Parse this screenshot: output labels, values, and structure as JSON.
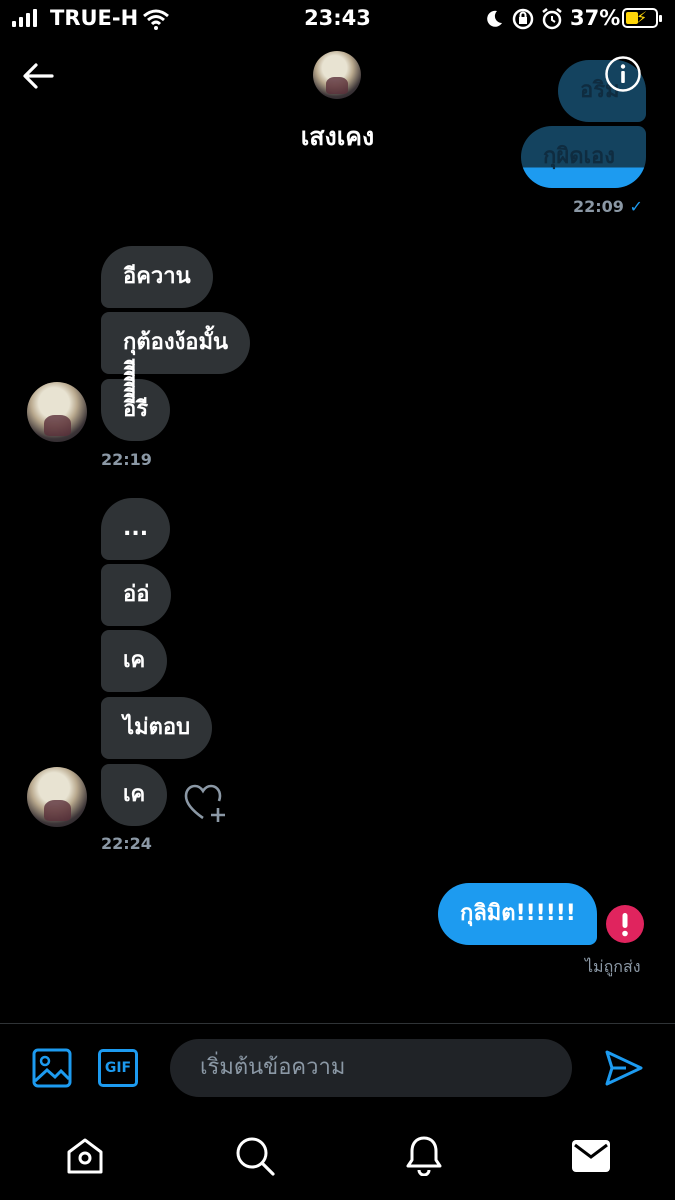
{
  "status_bar": {
    "carrier": "TRUE-H",
    "time": "23:43",
    "battery": "37%"
  },
  "header": {
    "name": "เสงเคง"
  },
  "messages": {
    "faded_1": "อริม",
    "faded_2": "กุผิดเอง",
    "ts_1": "22:09",
    "group1": [
      "อีควาน",
      "กุต้องง้อมั้น",
      "อีีีีีีีีรี"
    ],
    "ts_2": "22:19",
    "group2": [
      "...",
      "อ่อ่",
      "เค",
      "ไม่ตอบ",
      "เค"
    ],
    "ts_3": "22:24",
    "sent": "กุลิมิต!!!!!!",
    "not_sent": "ไม่ถูกส่ง"
  },
  "composer": {
    "placeholder": "เริ่มต้นข้อความ",
    "gif_label": "GIF"
  },
  "colors": {
    "accent": "#1d9bf0",
    "error": "#e0245e",
    "incoming": "#2f3336"
  }
}
